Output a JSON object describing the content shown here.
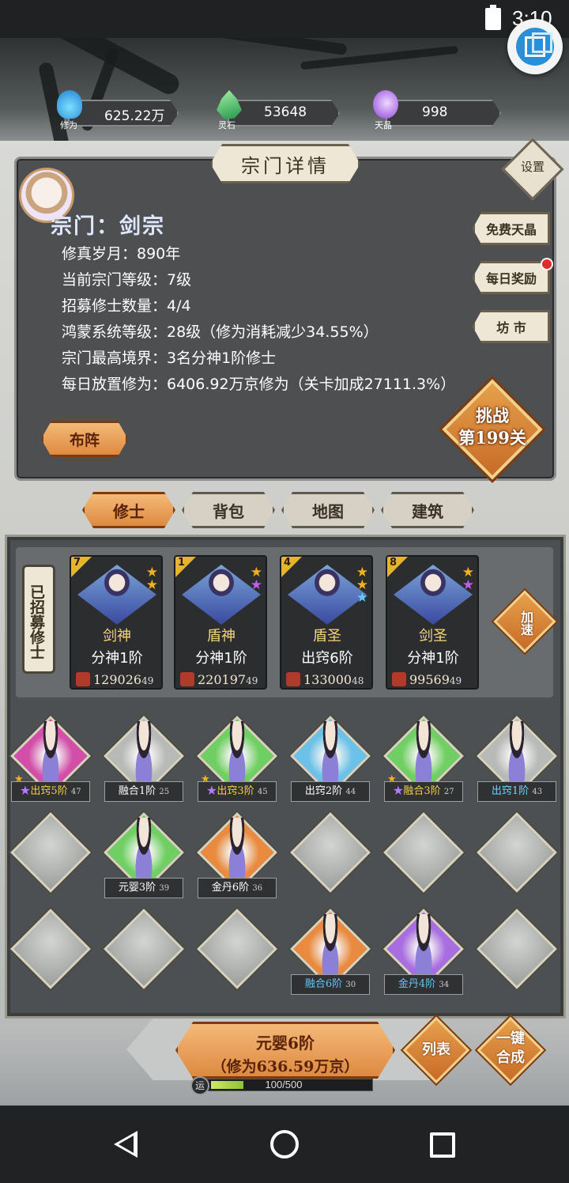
{
  "status_bar": {
    "time": "3:10"
  },
  "resources": [
    {
      "value": "625.22万京",
      "label": "修为",
      "color": "#1fb3f0"
    },
    {
      "value": "53648",
      "label": "灵石",
      "color": "#3fc46a"
    },
    {
      "value": "998",
      "label": "天晶",
      "color": "#a25ce6"
    }
  ],
  "panel": {
    "title": "宗门详情",
    "settings_label": "设置",
    "sect_name": "宗门：剑宗",
    "info": [
      "修真岁月：890年",
      "当前宗门等级：7级",
      "招募修士数量：4/4",
      "鸿蒙系统等级：28级（修为消耗减少34.55%）",
      "宗门最高境界：3名分神1阶修士",
      "每日放置修为：6406.92万京修为（关卡加成27111.3%）"
    ],
    "side_buttons": [
      "免费天晶",
      "每日奖励",
      "坊 市"
    ],
    "formation_button": "布阵",
    "challenge": {
      "line1": "挑战",
      "line2": "第199关"
    }
  },
  "tabs": [
    "修士",
    "背包",
    "地图",
    "建筑"
  ],
  "recruited": {
    "label": "已招募修士",
    "speed_button": "加速",
    "cards": [
      {
        "slot": "7",
        "name": "剑神",
        "rank": "分神1阶",
        "power": "129026",
        "level": "49",
        "stars": [
          "★",
          "★"
        ],
        "star_colors": [
          "#f3b21c",
          "#f3b21c"
        ]
      },
      {
        "slot": "1",
        "name": "盾神",
        "rank": "分神1阶",
        "power": "220197",
        "level": "49",
        "stars": [
          "★",
          "★"
        ],
        "star_colors": [
          "#f3b21c",
          "#c05cf0"
        ]
      },
      {
        "slot": "4",
        "name": "盾圣",
        "rank": "出窍6阶",
        "power": "133000",
        "level": "48",
        "stars": [
          "★",
          "★",
          "★"
        ],
        "star_colors": [
          "#f3b21c",
          "#f3b21c",
          "#5fc8ff"
        ]
      },
      {
        "slot": "8",
        "name": "剑圣",
        "rank": "分神1阶",
        "power": "99569",
        "level": "49",
        "stars": [
          "★",
          "★"
        ],
        "star_colors": [
          "#f3b21c",
          "#c05cf0"
        ]
      }
    ]
  },
  "grid": [
    {
      "tag": "出窍5阶",
      "level": "47",
      "bg": "#d24ea8",
      "star": true,
      "tag_color": "ylw"
    },
    {
      "tag": "融合1阶",
      "level": "25",
      "bg": "#b8bab8",
      "star": false,
      "tag_color": ""
    },
    {
      "tag": "出窍3阶",
      "level": "45",
      "bg": "#6fcf62",
      "star": true,
      "tag_color": "ylw"
    },
    {
      "tag": "出窍2阶",
      "level": "44",
      "bg": "#6cc1e8",
      "star": false,
      "tag_color": ""
    },
    {
      "tag": "融合3阶",
      "level": "27",
      "bg": "#6fcf62",
      "star": true,
      "tag_color": "ylw"
    },
    {
      "tag": "出窍1阶",
      "level": "43",
      "bg": "#b8bab8",
      "star": false,
      "tag_color": "cy"
    },
    {
      "tag": "",
      "level": "",
      "bg": "",
      "star": false,
      "tag_color": ""
    },
    {
      "tag": "元婴3阶",
      "level": "39",
      "bg": "#6fcf62",
      "star": false,
      "tag_color": ""
    },
    {
      "tag": "金丹6阶",
      "level": "36",
      "bg": "#e98a3e",
      "star": false,
      "tag_color": ""
    },
    {
      "tag": "",
      "level": "",
      "bg": "",
      "star": false,
      "tag_color": ""
    },
    {
      "tag": "",
      "level": "",
      "bg": "",
      "star": false,
      "tag_color": ""
    },
    {
      "tag": "",
      "level": "",
      "bg": "",
      "star": false,
      "tag_color": ""
    },
    {
      "tag": "",
      "level": "",
      "bg": "",
      "star": false,
      "tag_color": ""
    },
    {
      "tag": "",
      "level": "",
      "bg": "",
      "star": false,
      "tag_color": ""
    },
    {
      "tag": "",
      "level": "",
      "bg": "",
      "star": false,
      "tag_color": ""
    },
    {
      "tag": "融合6阶",
      "level": "30",
      "bg": "#e98a3e",
      "star": false,
      "tag_color": "bl"
    },
    {
      "tag": "金丹4阶",
      "level": "34",
      "bg": "#a86de0",
      "star": false,
      "tag_color": "bl"
    },
    {
      "tag": "",
      "level": "",
      "bg": "",
      "star": false,
      "tag_color": ""
    }
  ],
  "bottom": {
    "upgrade_line1": "元婴6阶",
    "upgrade_line2": "（修为636.59万京）",
    "list_button": "列表",
    "merge_button_line1": "一键",
    "merge_button_line2": "合成",
    "luck_label": "运",
    "luck_value": "100/500",
    "luck_progress": 0.2
  }
}
